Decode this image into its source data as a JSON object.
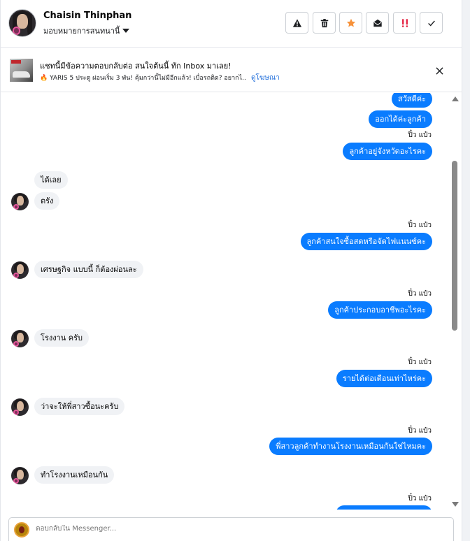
{
  "header": {
    "contact_name": "Chaisin Thinphan",
    "assign_label": "มอบหมายการสนทนานี้",
    "buttons": [
      {
        "name": "spam",
        "icon": "warning-icon"
      },
      {
        "name": "delete",
        "icon": "trash-icon"
      },
      {
        "name": "star",
        "icon": "star-icon",
        "color": "#f7923a"
      },
      {
        "name": "unread",
        "icon": "envelope-open-icon"
      },
      {
        "name": "follow-up",
        "icon": "exclamation-icon",
        "color": "#e41e3f"
      },
      {
        "name": "done",
        "icon": "check-icon"
      }
    ]
  },
  "banner": {
    "title": "แชทนี้มีข้อความตอบกลับต่อ สนใจต้นนี้ ทัก Inbox มาเลย!",
    "body": "🔥 YARIS 5 ประตู ผ่อนเริ่ม 3 พัน! คุ้มกว่านี้ไม่มีอีกแล้ว! เบื่อรถติด? อยากไ...",
    "link": "ดูโฆษณา"
  },
  "messages": [
    {
      "side": "out",
      "text": "สวัสดีค่ะ"
    },
    {
      "side": "out",
      "text": "ออกได้ค่ะลูกค้า"
    },
    {
      "side": "stamp",
      "text": "ปิ๋ว แป๋ว"
    },
    {
      "side": "out",
      "text": "ลูกค้าอยู่จังหวัดอะไรคะ"
    },
    {
      "side": "in",
      "text": "ได้เลย"
    },
    {
      "side": "in",
      "text": "ตรัง"
    },
    {
      "side": "stamp",
      "text": "ปิ๋ว แป๋ว"
    },
    {
      "side": "out",
      "text": "ลูกค้าสนใจซื้อสดหรือจัดไฟแนนซ์คะ"
    },
    {
      "side": "in",
      "text": "เศรษฐกิจ แบบนี้ ก็ต้องผ่อนละ"
    },
    {
      "side": "stamp",
      "text": "ปิ๋ว แป๋ว"
    },
    {
      "side": "out",
      "text": "ลูกค้าประกอบอาชีพอะไรคะ"
    },
    {
      "side": "in",
      "text": "โรงงาน ครับ"
    },
    {
      "side": "stamp",
      "text": "ปิ๋ว แป๋ว"
    },
    {
      "side": "out",
      "text": "รายได้ต่อเดือนเท่าไหร่คะ"
    },
    {
      "side": "in",
      "text": "ว่าจะให้พี่สาวซื้อนะครับ"
    },
    {
      "side": "stamp",
      "text": "ปิ๋ว แป๋ว"
    },
    {
      "side": "out",
      "text": "พี่สาวลูกค้าทำงานโรงงานเหมือนกันใช่ไหมคะ"
    },
    {
      "side": "in",
      "text": "ทำโรงงานเหมือนกัน"
    },
    {
      "side": "stamp",
      "text": "ปิ๋ว แป๋ว"
    }
  ],
  "composer": {
    "placeholder": "ตอบกลับใน Messenger..."
  }
}
